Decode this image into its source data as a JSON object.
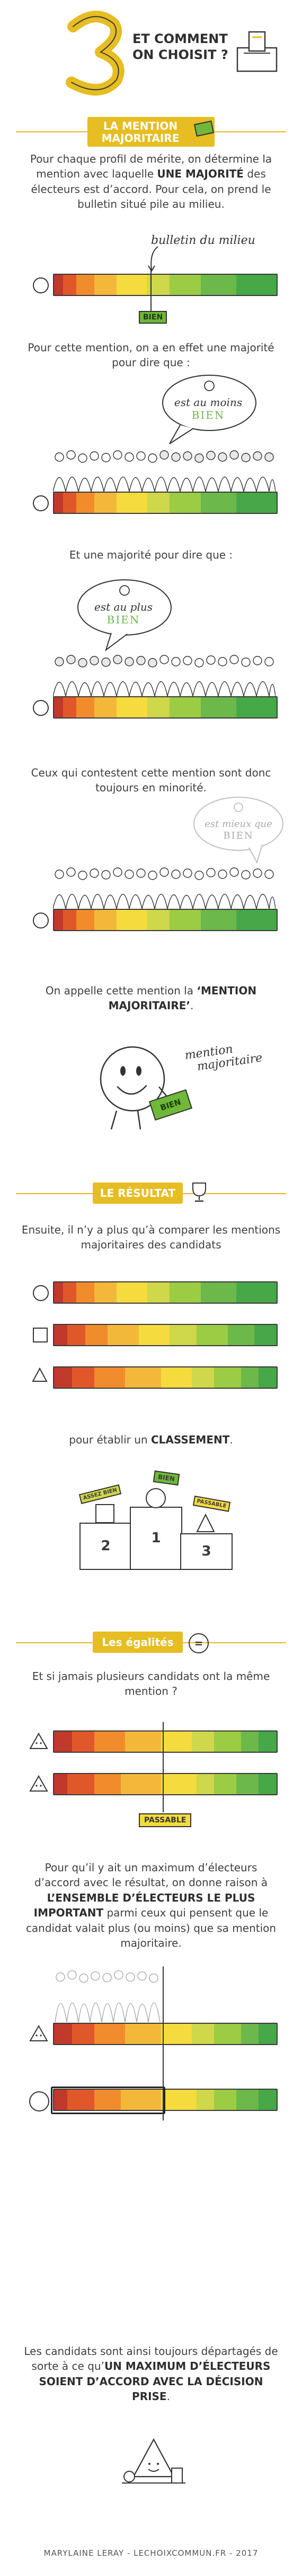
{
  "colors": {
    "accent": "#e6bd22",
    "scale": [
      "#c0392b",
      "#e0582a",
      "#f08c2c",
      "#f3b83a",
      "#f5db3e",
      "#cfd74a",
      "#9ccc43",
      "#6cb84a",
      "#46a847"
    ]
  },
  "header": {
    "number": "3",
    "title_line1": "ET COMMENT",
    "title_line2": "ON CHOISIT ?"
  },
  "section1": {
    "title_line1": "LA MENTION",
    "title_line2": "MAJORITAIRE",
    "p1_a": "Pour chaque profil de mérite, on détermine la mention avec laquelle ",
    "p1_b": "UNE MAJORITÉ",
    "p1_c": " des électeurs est d’accord. Pour cela, on prend le bulletin situé pile au milieu.",
    "label_middle": "bulletin du milieu",
    "tag_bien": "BIEN",
    "p2": "Pour cette mention, on a en effet une majorité pour dire que :",
    "bubble1_line1": "est au moins",
    "bubble1_line2": "BIEN",
    "p3": "Et une majorité pour dire que :",
    "bubble2_line1": "est au plus",
    "bubble2_line2": "BIEN",
    "p4": "Ceux qui contestent cette mention sont donc toujours en minorité.",
    "bubble3_line1": "est mieux que",
    "bubble3_line2": "BIEN",
    "p5_a": "On appelle cette mention la ",
    "p5_b": "‘MENTION MAJORITAIRE’",
    "p5_c": ".",
    "mention_label_line1": "mention",
    "mention_label_line2": "majoritaire",
    "sign_bien": "BIEN"
  },
  "section2": {
    "title": "LE RÉSULTAT",
    "p1": "Ensuite, il n’y a plus qu’à comparer les mentions majoritaires des candidats",
    "p2_a": "pour établir un ",
    "p2_b": "CLASSEMENT",
    "p2_c": ".",
    "podium_bien": "BIEN",
    "podium_assez_bien": "ASSEZ BIEN",
    "podium_passable": "PASSABLE",
    "podium_ranks": [
      "1",
      "2",
      "3"
    ]
  },
  "section3": {
    "title": "Les égalités",
    "p1": "Et si jamais plusieurs candidats ont la même mention ?",
    "tag_passable": "PASSABLE",
    "p2_a": "Pour qu’il y ait un maximum d’électeurs d’accord avec le résultat, on donne raison à ",
    "p2_b": "L’ENSEMBLE D’ÉLECTEURS LE PLUS IMPORTANT",
    "p2_c": " parmi ceux qui pensent que le candidat valait plus (ou moins) que sa mention majoritaire.",
    "p3_a": "Les candidats sont ainsi toujours départagés de sorte à ce qu’",
    "p3_b": "UN MAXIMUM D’ÉLECTEURS SOIENT D’ACCORD AVEC LA DÉCISION PRISE",
    "p3_c": "."
  },
  "footer": "MARYLAINE LERAY - LECHOIXCOMMUN.FR - 2017"
}
